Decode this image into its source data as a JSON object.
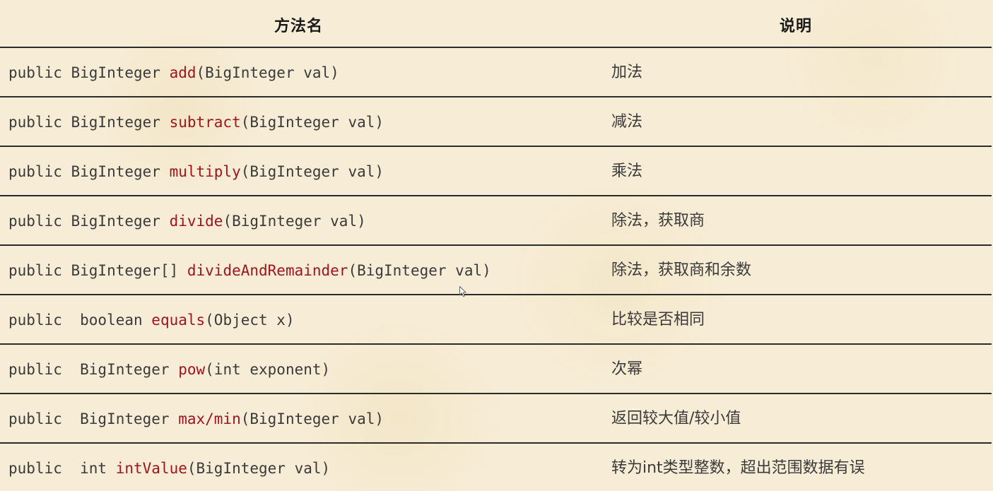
{
  "header": {
    "method_col": "方法名",
    "desc_col": "说明"
  },
  "rows": [
    {
      "prefix": "public BigInteger ",
      "method": "add",
      "params": "(BigInteger val)",
      "desc": "加法"
    },
    {
      "prefix": "public BigInteger ",
      "method": "subtract",
      "params": "(BigInteger val)",
      "desc": "减法"
    },
    {
      "prefix": "public BigInteger ",
      "method": "multiply",
      "params": "(BigInteger val)",
      "desc": "乘法"
    },
    {
      "prefix": "public BigInteger ",
      "method": "divide",
      "params": "(BigInteger val)",
      "desc": "除法，获取商"
    },
    {
      "prefix": "public BigInteger[] ",
      "method": "divideAndRemainder",
      "params": "(BigInteger val)",
      "desc": "除法，获取商和余数"
    },
    {
      "prefix": "public  boolean ",
      "method": "equals",
      "params": "(Object x)",
      "desc": "比较是否相同"
    },
    {
      "prefix": "public  BigInteger ",
      "method": "pow",
      "params": "(int exponent)",
      "desc": "次幂"
    },
    {
      "prefix": "public  BigInteger ",
      "method": "max/min",
      "params": "(BigInteger val)",
      "desc": "返回较大值/较小值"
    },
    {
      "prefix": "public  int ",
      "method": "intValue",
      "params": "(BigInteger val)",
      "desc": "转为int类型整数，超出范围数据有误"
    }
  ],
  "colors": {
    "method_name": "#a0141e",
    "text": "#3a3a3a",
    "background": "#f7edd6",
    "rule": "#2b2b2b"
  }
}
